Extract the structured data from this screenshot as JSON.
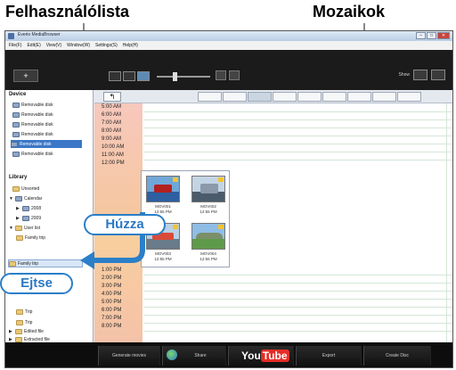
{
  "callouts": {
    "user_list": "Felhasználólista",
    "mosaics": "Mozaikok",
    "drag": "Húzza",
    "drop": "Ejtse"
  },
  "window": {
    "title": "Everio MediaBrowser",
    "menu": [
      "File(F)",
      "Edit(E)",
      "View(V)",
      "Window(W)",
      "Settings(S)",
      "Help(H)"
    ]
  },
  "toolbar": {
    "add_label": "+",
    "show_label": "Show"
  },
  "sidebar": {
    "device_header": "Device",
    "devices": [
      "Removable disk",
      "Removable disk",
      "Removable disk",
      "Removable disk",
      "Removable disk",
      "Removable disk"
    ],
    "library_header": "Library",
    "library": [
      "Unsorted",
      "Calendar",
      "2008",
      "2009",
      "User list",
      "Family trip",
      "Family trip",
      "Trip",
      "Trip",
      "Edited file",
      "Extracted file"
    ]
  },
  "nav": {
    "tabs": [
      "",
      "",
      "",
      "",
      "",
      "",
      "",
      "",
      ""
    ]
  },
  "times": [
    "5:00 AM",
    "6:00 AM",
    "7:00 AM",
    "8:00 AM",
    "9:00 AM",
    "10:00 AM",
    "11:00 AM",
    "12:00 PM",
    "1:00 PM",
    "2:00 PM",
    "3:00 PM",
    "4:00 PM",
    "5:00 PM",
    "6:00 PM",
    "7:00 PM",
    "8:00 PM"
  ],
  "mosaic": {
    "items": [
      {
        "line1": "MOV001",
        "line2": "12:55 PM"
      },
      {
        "line1": "MOV002",
        "line2": "12:55 PM"
      },
      {
        "line1": "MOV003",
        "line2": "12:55 PM"
      },
      {
        "line1": "MOV004",
        "line2": "12:55 PM"
      }
    ]
  },
  "bottom": {
    "buttons": [
      "Generate movies",
      "Share",
      "YouTube",
      "Export",
      "Create Disc"
    ],
    "youtube": {
      "you": "You",
      "tube": "Tube"
    }
  },
  "colors": {
    "accent": "#2b7fc8",
    "toolbar": "#1b1b1b"
  }
}
